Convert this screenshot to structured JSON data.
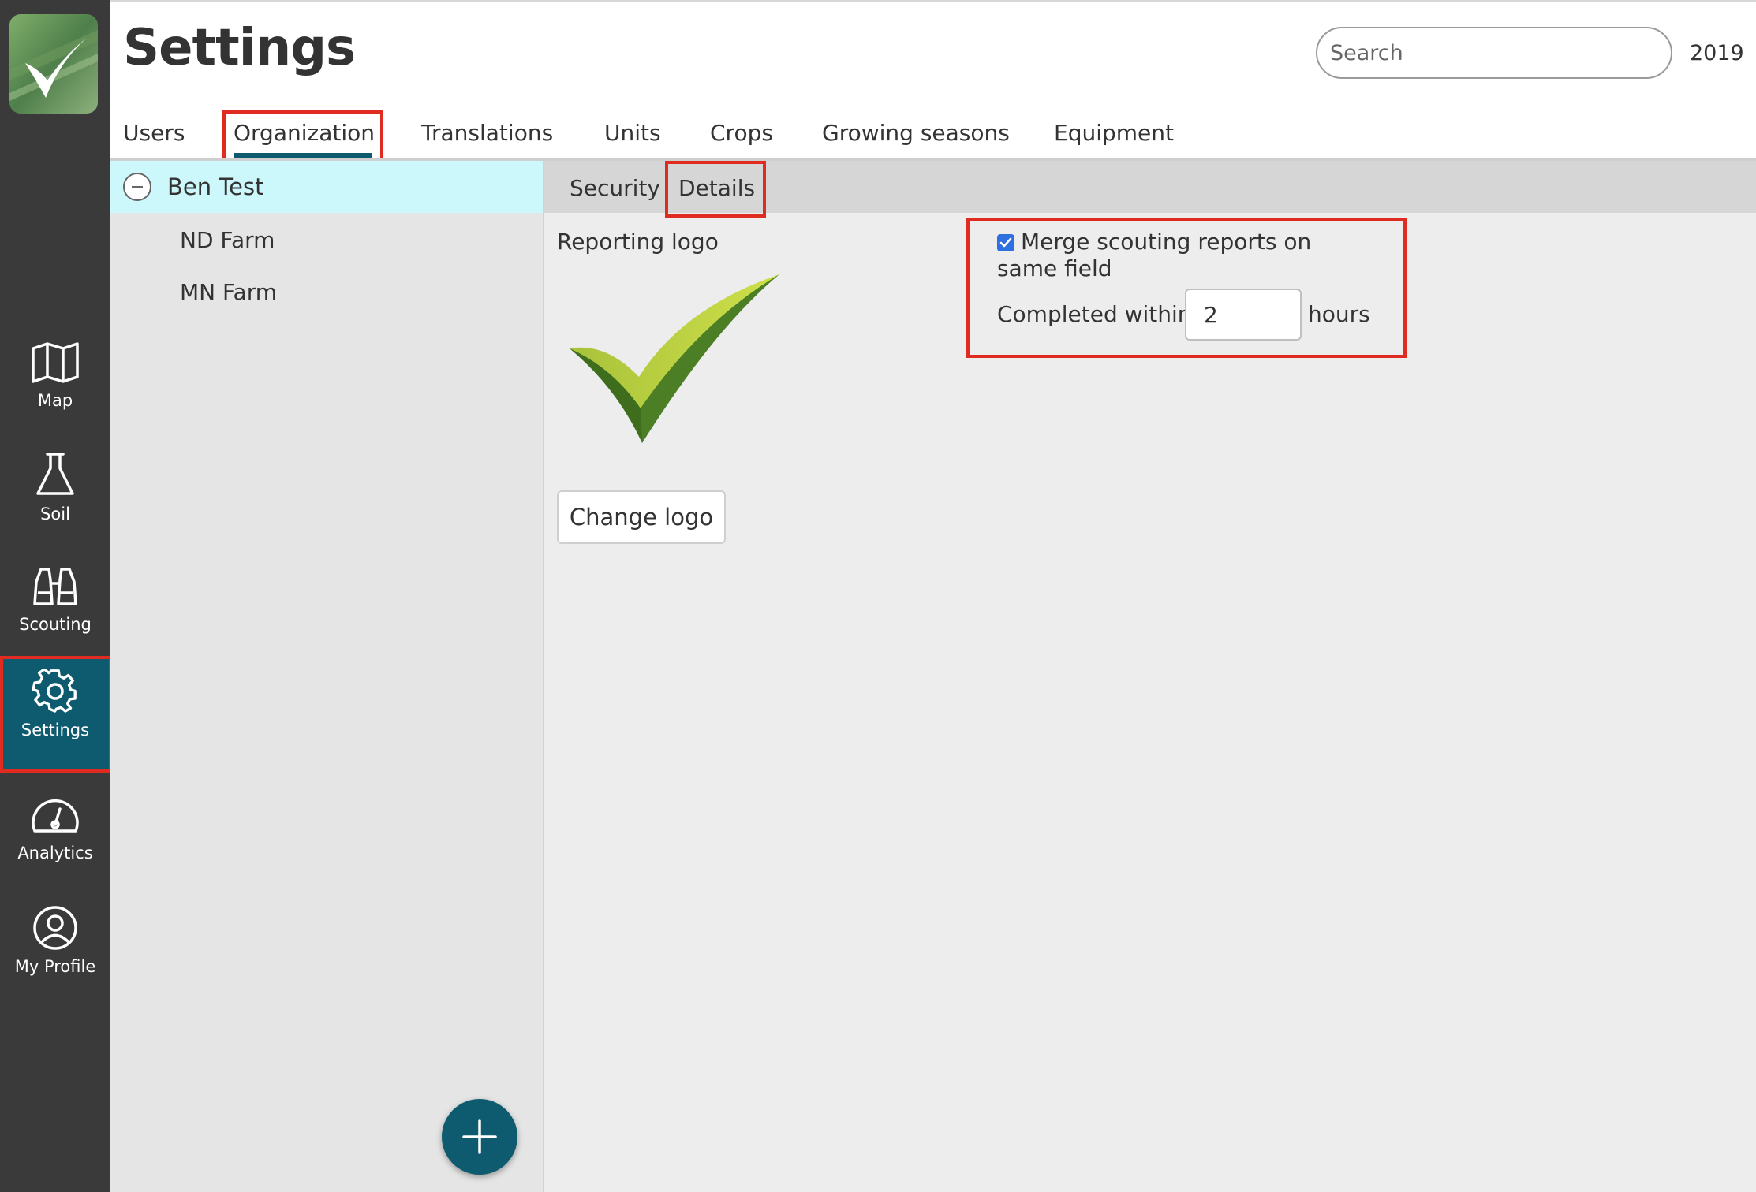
{
  "header": {
    "title": "Settings",
    "search_placeholder": "Search",
    "year": "2019"
  },
  "tabs": [
    {
      "label": "Users"
    },
    {
      "label": "Organization",
      "active": true
    },
    {
      "label": "Translations"
    },
    {
      "label": "Units"
    },
    {
      "label": "Crops"
    },
    {
      "label": "Growing seasons"
    },
    {
      "label": "Equipment"
    }
  ],
  "sidebar": {
    "items": [
      {
        "label": "Map",
        "icon": "map-icon"
      },
      {
        "label": "Soil",
        "icon": "flask-icon"
      },
      {
        "label": "Scouting",
        "icon": "binoculars-icon"
      },
      {
        "label": "Settings",
        "icon": "gear-icon",
        "active": true
      },
      {
        "label": "Analytics",
        "icon": "gauge-icon"
      },
      {
        "label": "My Profile",
        "icon": "user-icon"
      }
    ]
  },
  "org_tree": {
    "root": "Ben Test",
    "children": [
      "ND Farm",
      "MN Farm"
    ]
  },
  "subtabs": [
    {
      "label": "Security"
    },
    {
      "label": "Details",
      "active": true
    }
  ],
  "details": {
    "reporting_logo_label": "Reporting logo",
    "change_logo_label": "Change logo",
    "merge_label": "Merge scouting reports on same field",
    "merge_checked": true,
    "completed_within_label": "Completed within",
    "hours_value": "2",
    "hours_label": "hours"
  },
  "colors": {
    "sidebar": "#3a3a3a",
    "accent": "#0e5b6f",
    "highlight": "#e02b20",
    "selected_row": "#ccf7fb"
  }
}
